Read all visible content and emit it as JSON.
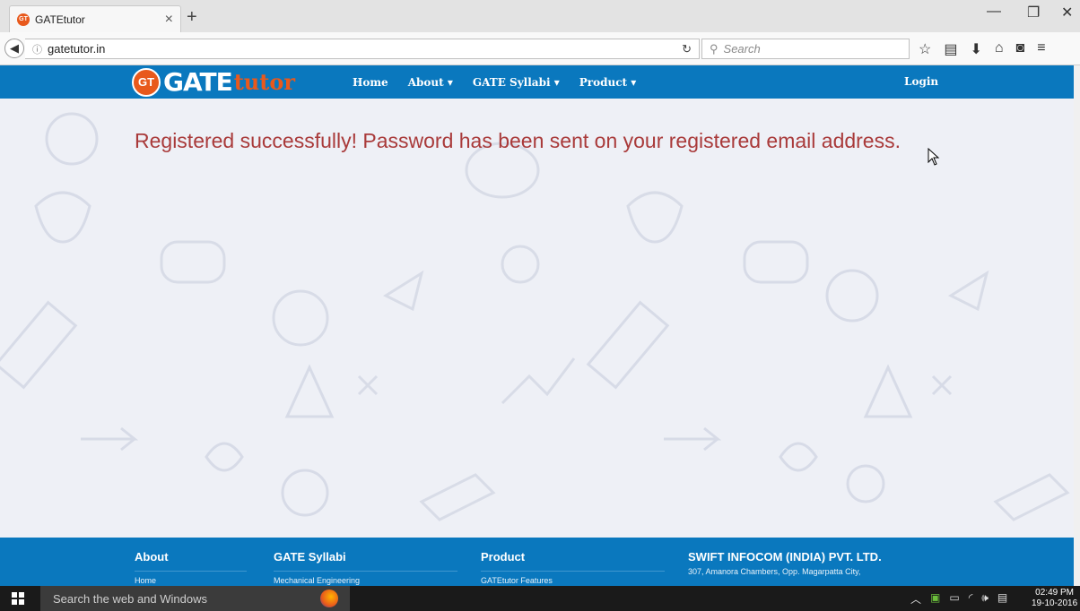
{
  "browser": {
    "tab_title": "GATEtutor",
    "tab_favicon_text": "GT",
    "url": "gatetutor.in",
    "search_placeholder": "Search"
  },
  "site": {
    "logo": {
      "badge": "GT",
      "word1": "GATE",
      "word2": "tutor"
    },
    "menu": [
      "Home",
      "About",
      "GATE Syllabi",
      "Product"
    ],
    "login_label": "Login",
    "message": "Registered successfully! Password has been sent on your registered email address.",
    "footer": {
      "about": {
        "heading": "About",
        "items": [
          "Home"
        ]
      },
      "syllabi": {
        "heading": "GATE Syllabi",
        "items": [
          "Mechanical Engineering"
        ]
      },
      "product": {
        "heading": "Product",
        "items": [
          "GATEtutor Features"
        ]
      },
      "company": {
        "heading": "SWIFT INFOCOM (INDIA) PVT. LTD.",
        "address": "307, Amanora Chambers, Opp. Magarpatta City,"
      }
    }
  },
  "taskbar": {
    "search_placeholder": "Search the web and Windows",
    "time": "02:49 PM",
    "date": "19-10-2016"
  },
  "colors": {
    "brand_blue": "#0a78be",
    "brand_orange": "#e8591c",
    "message_red": "#a93a3a"
  }
}
